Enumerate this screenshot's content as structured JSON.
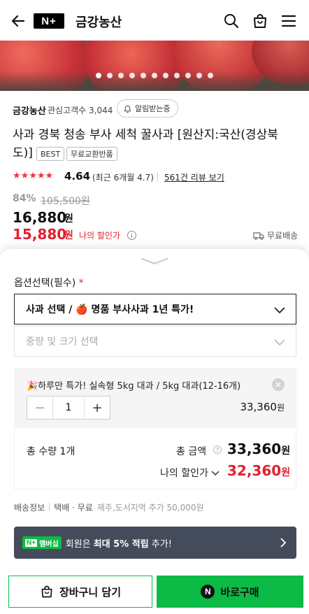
{
  "header": {
    "logo_text": "N+",
    "store_name": "금강농산"
  },
  "gallery": {
    "dot_count": 11,
    "active_index": 0
  },
  "seller": {
    "name": "금강농산",
    "followers": "관심고객수 3,044",
    "alarm_label": "알림받는중"
  },
  "product": {
    "title_line1": "사과 경북 청송 부사 세척 꿀사과 [원산지:국산(경상북",
    "title_line2": "도)]",
    "badges": [
      "BEST",
      "무료교환반품"
    ],
    "rating_stars": 5,
    "rating": "4.64",
    "rating_recent": "(최근 6개월 4.7)",
    "reviews_link": "561건 리뷰 보기"
  },
  "pricing": {
    "discount": "84%",
    "original_price": "105,500원",
    "price": "16,880",
    "price_unit": "원",
    "my_price": "15,880",
    "my_price_unit": "원",
    "my_price_label": "나의 할인가",
    "info_icon": "i",
    "shipping": "무료배송"
  },
  "options": {
    "title": "옵션선택(필수)",
    "required_mark": "*",
    "select1_value": "사과 선택 / 🍎 명품 부사사과 1년 특가!",
    "select2_placeholder": "중량 및 크기 선택"
  },
  "selected_item": {
    "name": "🎉하루만 특가! 실속형 5kg 대과 / 5kg 대과(12-16개)",
    "quantity": "1",
    "price": "33,360",
    "price_unit": "원",
    "minus": "−",
    "plus": "+"
  },
  "totals": {
    "qty_label": "총 수량",
    "qty_value": "1",
    "qty_unit": "개",
    "amount_label": "총 금액",
    "amount_value": "33,360",
    "amount_unit": "원",
    "help_icon": "?",
    "my_price_label": "나의 할인가",
    "my_price_value": "32,360",
    "my_price_unit": "원"
  },
  "delivery": {
    "label": "배송정보",
    "method": "택배 · 무료",
    "extra": "제주,도서지역 추가 50,000원"
  },
  "membership": {
    "badge_np": "N+",
    "badge_text": "멤버십",
    "text_prefix": "회원은 ",
    "text_bold": "최대 5% 적립",
    "text_suffix": " 추가!"
  },
  "actions": {
    "cart_label": "장바구니 담기",
    "buy_label": "바로구매",
    "buy_icon_letter": "N"
  },
  "colors": {
    "accent_red": "#e0212f",
    "naver_green": "#0bbb46",
    "member_bar": "#444b5a"
  }
}
